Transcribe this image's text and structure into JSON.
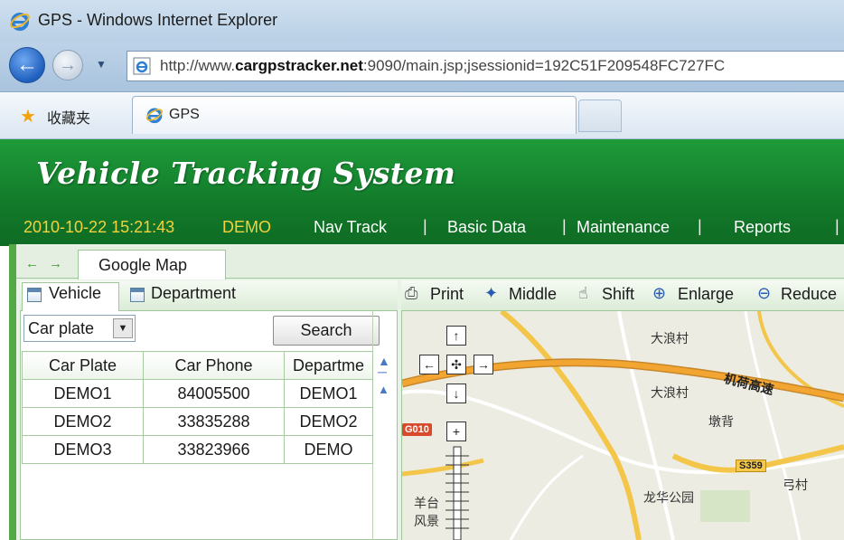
{
  "browser": {
    "window_title": "GPS - Windows Internet Explorer",
    "url_prefix": "http://www.",
    "url_domain": "cargpstracker.net",
    "url_rest": ":9090/main.jsp;jsessionid=192C51F209548FC727FC",
    "favorites_label": "收藏夹",
    "tab_label": "GPS"
  },
  "app": {
    "title": "Vehicle Tracking System",
    "datetime": "2010-10-22 15:21:43",
    "user": "DEMO",
    "menu": [
      "Nav Track",
      "Basic Data",
      "Maintenance",
      "Reports"
    ],
    "separator": "|"
  },
  "tabs": {
    "back_arrow": "←",
    "forward_arrow": "→",
    "active": "Google Map"
  },
  "left_panel": {
    "tabs": [
      "Vehicle",
      "Department"
    ],
    "filter_select": "Car plate",
    "search_button": "Search",
    "columns": [
      "Car Plate",
      "Car Phone",
      "Departme"
    ],
    "rows": [
      [
        "DEMO1",
        "84005500",
        "DEMO1"
      ],
      [
        "DEMO2",
        "33835288",
        "DEMO2"
      ],
      [
        "DEMO3",
        "33823966",
        "DEMO"
      ]
    ]
  },
  "map": {
    "toolbar": [
      "Print",
      "Middle",
      "Shift",
      "Enlarge",
      "Reduce"
    ],
    "labels": {
      "place1": "大浪村",
      "place2": "大浪村",
      "place3": "墩背",
      "place4": "弓村",
      "park": "龙华公园",
      "scenic1": "羊台",
      "scenic2": "风景",
      "highway": "机荷高速",
      "route_g": "G010",
      "route_s": "S359"
    },
    "controls": {
      "up": "↑",
      "left": "←",
      "center": "✣",
      "right": "→",
      "down": "↓",
      "zoom_in": "+"
    }
  },
  "colors": {
    "header_green": "#127a2a",
    "datetime_yellow": "#f3d23b",
    "highway_orange": "#f2a530"
  }
}
